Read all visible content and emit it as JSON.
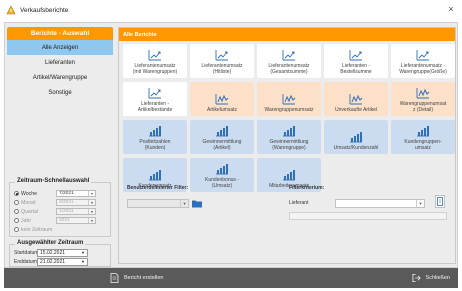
{
  "window": {
    "title": "Verkaufsberichte",
    "close_glyph": "×"
  },
  "left_panel": {
    "header": "Berichte - Auswahl",
    "items": [
      {
        "label": "Alle Anzeigen",
        "active": true
      },
      {
        "label": "Lieferanten",
        "active": false
      },
      {
        "label": "Artikel/Warengruppe",
        "active": false
      },
      {
        "label": "Sonstige",
        "active": false
      }
    ]
  },
  "quick_period": {
    "title": "Zeitraum-Schnellauswahl",
    "options": [
      {
        "label": "Woche",
        "value": "7/2021",
        "selected": true,
        "enabled": true
      },
      {
        "label": "Monat",
        "value": "2/2021",
        "selected": false,
        "enabled": false
      },
      {
        "label": "Quartal",
        "value": "1/2021",
        "selected": false,
        "enabled": false
      },
      {
        "label": "Jahr",
        "value": "2021",
        "selected": false,
        "enabled": false
      },
      {
        "label": "kein Zeitraum",
        "value": "",
        "selected": false,
        "enabled": false
      }
    ]
  },
  "selected_period": {
    "title": "Ausgewählter Zeitraum",
    "start_label": "Startdatum",
    "start_value": "15.02.2021",
    "end_label": "Enddatum",
    "end_value": "21.02.2021"
  },
  "right_panel": {
    "header": "Alle Berichte",
    "tiles": [
      {
        "label1": "Lieferantenumsatz",
        "label2": "(mit Warengruppen)",
        "style": "white",
        "icon": "line-chart-icon"
      },
      {
        "label1": "Lieferantenumsatz",
        "label2": "(Hitliste)",
        "style": "white",
        "icon": "line-chart-icon"
      },
      {
        "label1": "Lieferantenumsatz",
        "label2": "(Gesamtsumme)",
        "style": "white",
        "icon": "line-chart-icon"
      },
      {
        "label1": "Lieferanten -",
        "label2": "Bestellsumme",
        "style": "white",
        "icon": "line-chart-icon"
      },
      {
        "label1": "Lieferantenumsatz -",
        "label2": "Warengruppe(Größe)",
        "style": "white",
        "icon": "line-chart-icon"
      },
      {
        "label1": "Lieferanten -",
        "label2": "Artikelbestände",
        "style": "white",
        "icon": "line-chart-icon"
      },
      {
        "label1": "Artikelumsatz",
        "label2": "",
        "style": "peach",
        "icon": "wave-chart-icon"
      },
      {
        "label1": "Warengruppenumsatz",
        "label2": "",
        "style": "peach",
        "icon": "wave-chart-icon"
      },
      {
        "label1": "Unverkaufte Artikel",
        "label2": "",
        "style": "peach",
        "icon": "wave-chart-icon"
      },
      {
        "label1": "Warengruppenumsat",
        "label2": "z (Detail)",
        "style": "peach",
        "icon": "wave-chart-icon"
      },
      {
        "label1": "Postleitzahlen",
        "label2": "(Kunden)",
        "style": "blue",
        "icon": "bar-chart-icon"
      },
      {
        "label1": "Gewinnermittlung",
        "label2": "(Artikel)",
        "style": "blue",
        "icon": "bar-chart-icon"
      },
      {
        "label1": "Gewinnermittlung",
        "label2": "(Warengruppe)",
        "style": "blue",
        "icon": "bar-chart-icon"
      },
      {
        "label1": "Umsatz/Kundenzahl",
        "label2": "",
        "style": "blue",
        "icon": "bar-chart-icon"
      },
      {
        "label1": "Kundengruppen-",
        "label2": "umsatz",
        "style": "blue",
        "icon": "bar-chart-icon"
      },
      {
        "label1": "Kundenumsatz",
        "label2": "",
        "style": "blue",
        "icon": "bar-chart-icon"
      },
      {
        "label1": "Kundenbonus -",
        "label2": "(Umsatz)",
        "style": "blue",
        "icon": "bar-chart-icon"
      },
      {
        "label1": "Mitarbeiterumsatz",
        "label2": "",
        "style": "blue",
        "icon": "bar-chart-icon"
      }
    ],
    "user_filter": {
      "label": "Benutzerdefinierter Filter:"
    },
    "filter_criteria": {
      "label": "Filterkriterium:",
      "sub_label": "Lieferant"
    }
  },
  "footer": {
    "report_button": "Bericht erstellen",
    "close_button": "Schließen"
  },
  "colors": {
    "accent_orange": "#ff9800",
    "active_item": "#8ec7ef",
    "tile_peach": "#fde0c8",
    "tile_blue": "#ccdcf0",
    "icon_blue": "#2f6fba",
    "footer_bg": "#5a5a5a"
  }
}
